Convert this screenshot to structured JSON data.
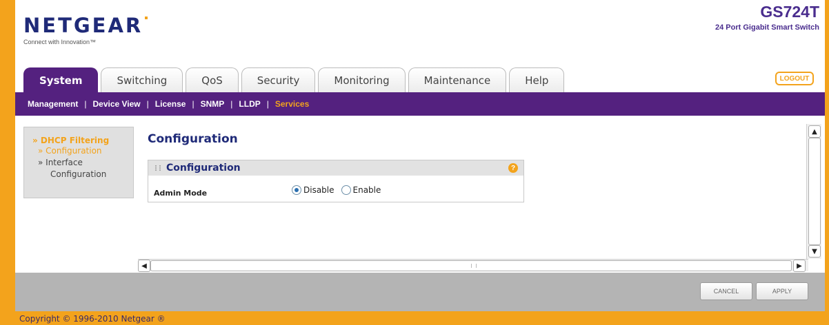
{
  "header": {
    "brand": "NETGEAR",
    "tagline": "Connect with Innovation™",
    "model": "GS724T",
    "model_description": "24 Port Gigabit Smart Switch",
    "logout_label": "LOGOUT"
  },
  "tabs": [
    {
      "label": "System",
      "active": true
    },
    {
      "label": "Switching",
      "active": false
    },
    {
      "label": "QoS",
      "active": false
    },
    {
      "label": "Security",
      "active": false
    },
    {
      "label": "Monitoring",
      "active": false
    },
    {
      "label": "Maintenance",
      "active": false
    },
    {
      "label": "Help",
      "active": false
    }
  ],
  "subnav": [
    {
      "label": "Management",
      "active": false
    },
    {
      "label": "Device View",
      "active": false
    },
    {
      "label": "License",
      "active": false
    },
    {
      "label": "SNMP",
      "active": false
    },
    {
      "label": "LLDP",
      "active": false
    },
    {
      "label": "Services",
      "active": true
    }
  ],
  "leftnav": {
    "section": "» DHCP Filtering",
    "items": [
      {
        "label": "» Configuration",
        "active": true
      },
      {
        "label": "» Interface",
        "active": false
      },
      {
        "label": "Configuration",
        "active": false
      }
    ]
  },
  "content": {
    "page_title": "Configuration",
    "panel_title": "Configuration",
    "help_label": "?",
    "admin_mode_label": "Admin Mode",
    "admin_mode_options": [
      "Disable",
      "Enable"
    ],
    "admin_mode_selected": "Disable"
  },
  "scroll": {
    "up": "▲",
    "down": "▼",
    "left": "◀",
    "right": "▶"
  },
  "buttons": {
    "cancel": "CANCEL",
    "apply": "APPLY"
  },
  "footer": {
    "copyright": "Copyright © 1996-2010 Netgear ®"
  },
  "colors": {
    "accent": "#f3a31c",
    "brand_purple": "#54217f",
    "navy": "#1f2a78"
  }
}
